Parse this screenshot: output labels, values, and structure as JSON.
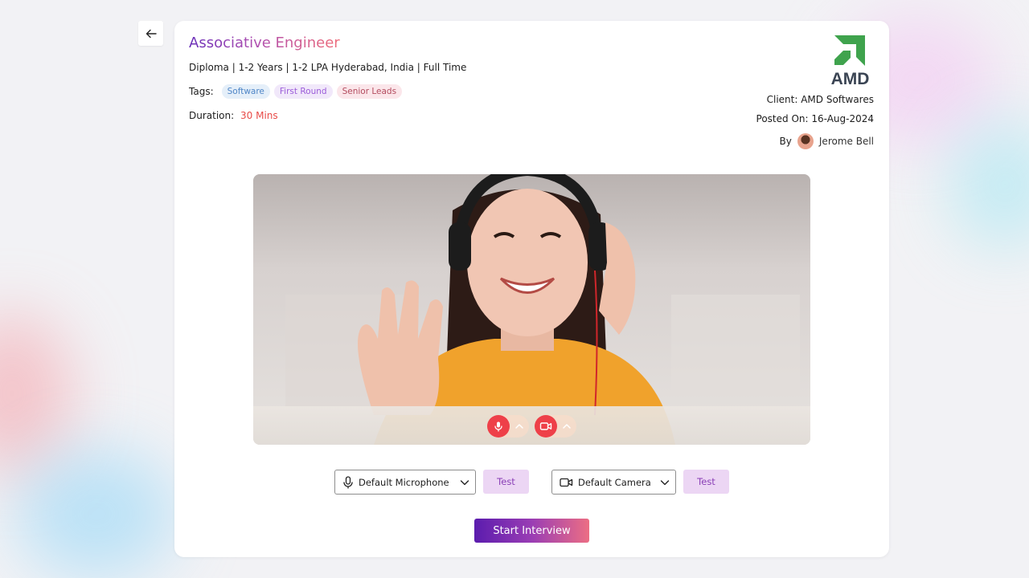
{
  "job": {
    "title": "Associative Engineer",
    "meta": "Diploma | 1-2 Years | 1-2 LPA Hyderabad, India | Full Time",
    "tags_label": "Tags:",
    "tags": [
      "Software",
      "First Round",
      "Senior Leads"
    ],
    "duration_label": "Duration:",
    "duration_value": "30 Mins"
  },
  "client": {
    "logo_text": "AMD",
    "client_line": "Client: AMD Softwares",
    "posted_line": "Posted On: 16-Aug-2024",
    "by_label": "By",
    "author": "Jerome Bell"
  },
  "devices": {
    "microphone": "Default Microphone",
    "camera": "Default Camera",
    "test_label": "Test"
  },
  "actions": {
    "start": "Start Interview"
  },
  "colors": {
    "accent_purple": "#6a2fb9",
    "accent_pink": "#ef6d7a",
    "duration_red": "#e84b48",
    "amd_green": "#3fa34d",
    "amd_gray": "#3a4453",
    "control_red": "#ee4049"
  },
  "icons": {
    "back": "arrow-left-icon",
    "mic": "microphone-icon",
    "camera": "video-camera-icon",
    "chevron": "chevron-down-icon"
  }
}
